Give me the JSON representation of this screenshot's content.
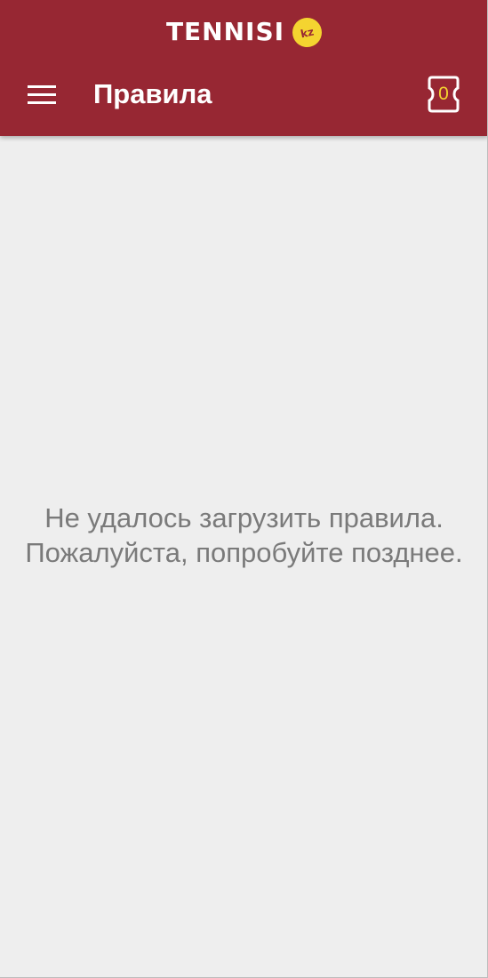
{
  "header": {
    "logo_text": "TENNISI",
    "logo_badge": "kz",
    "title": "Правила",
    "coupon_count": "0",
    "menu_icon": "hamburger-menu-icon",
    "coupon_icon": "bet-slip-coupon-icon"
  },
  "main": {
    "error_message": "Не удалось загрузить правила. Пожалуйста, попробуйте позднее."
  },
  "colors": {
    "brand": "#972733",
    "accent": "#f4d430",
    "background": "#eeeeee",
    "message_text": "#7a7a7a"
  }
}
